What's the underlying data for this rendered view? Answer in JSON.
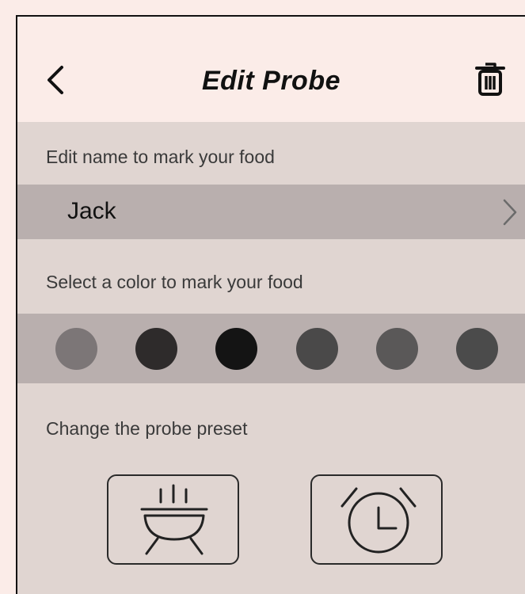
{
  "header": {
    "title": "Edit Probe",
    "back_icon": "chevron-left-icon",
    "delete_icon": "trash-icon"
  },
  "name_section": {
    "label": "Edit name to mark your food",
    "value": "Jack",
    "chevron_icon": "chevron-right-icon"
  },
  "color_section": {
    "label": "Select a color to mark your food",
    "colors": [
      "#7c7677",
      "#2e2b2b",
      "#141414",
      "#4a4949",
      "#5a5858",
      "#4b4b4b"
    ]
  },
  "preset_section": {
    "label": "Change the probe preset",
    "presets": [
      {
        "icon": "grill-icon"
      },
      {
        "icon": "alarm-clock-icon"
      }
    ]
  },
  "colors": {
    "page_bg": "#fbece8",
    "panel_bg": "#e0d5d1",
    "row_bg": "#b9afae"
  }
}
